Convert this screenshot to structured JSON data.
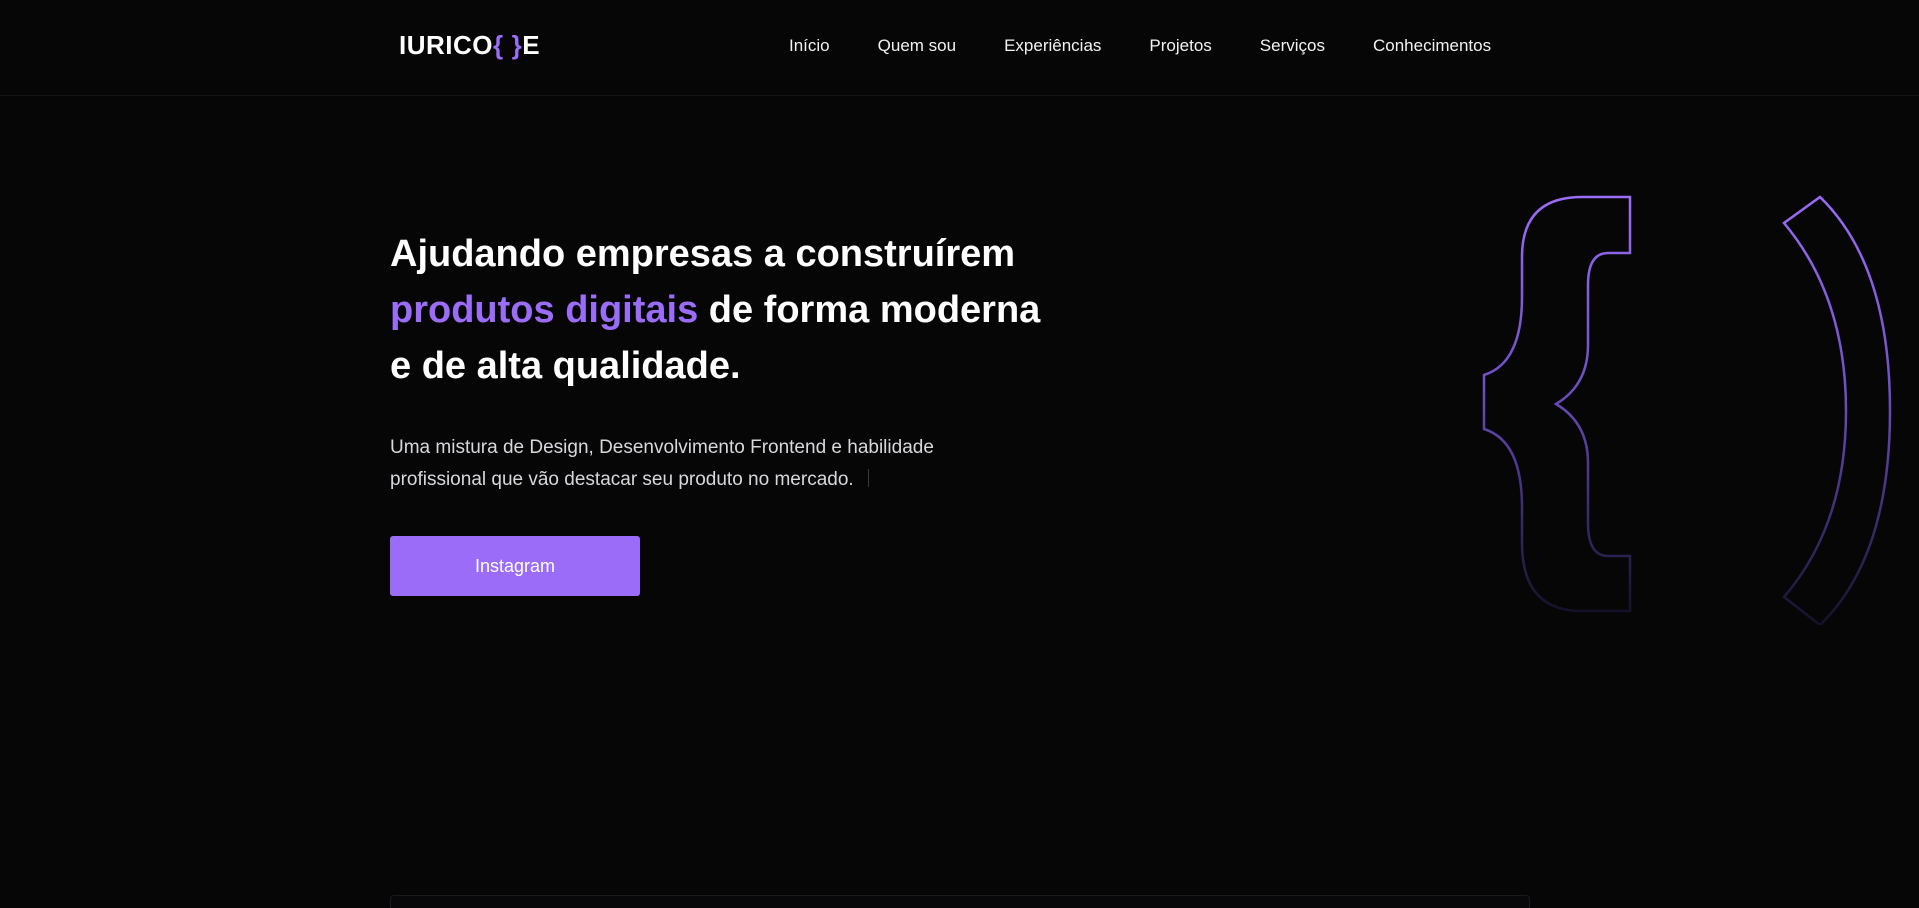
{
  "header": {
    "logo": {
      "prefix": "IURICO",
      "brace_open": "{",
      "brace_close": "}",
      "suffix": "E"
    },
    "nav": [
      {
        "label": "Início"
      },
      {
        "label": "Quem sou"
      },
      {
        "label": "Experiências"
      },
      {
        "label": "Projetos"
      },
      {
        "label": "Serviços"
      },
      {
        "label": "Conhecimentos"
      }
    ]
  },
  "hero": {
    "title_part1": "Ajudando empresas a construírem",
    "title_accent": "produtos digitais",
    "title_part2": "de forma moderna e de alta qualidade.",
    "subtitle": "Uma mistura de Design, Desenvolvimento Frontend e habilidade profissional que vão destacar seu produto no mercado.",
    "cta_label": "Instagram"
  },
  "colors": {
    "background": "#060607",
    "accent": "#9b6cf8",
    "text": "#ffffff",
    "muted_text": "#d7d7dc"
  },
  "icons": {
    "decoration": "curly-braces-outline"
  }
}
